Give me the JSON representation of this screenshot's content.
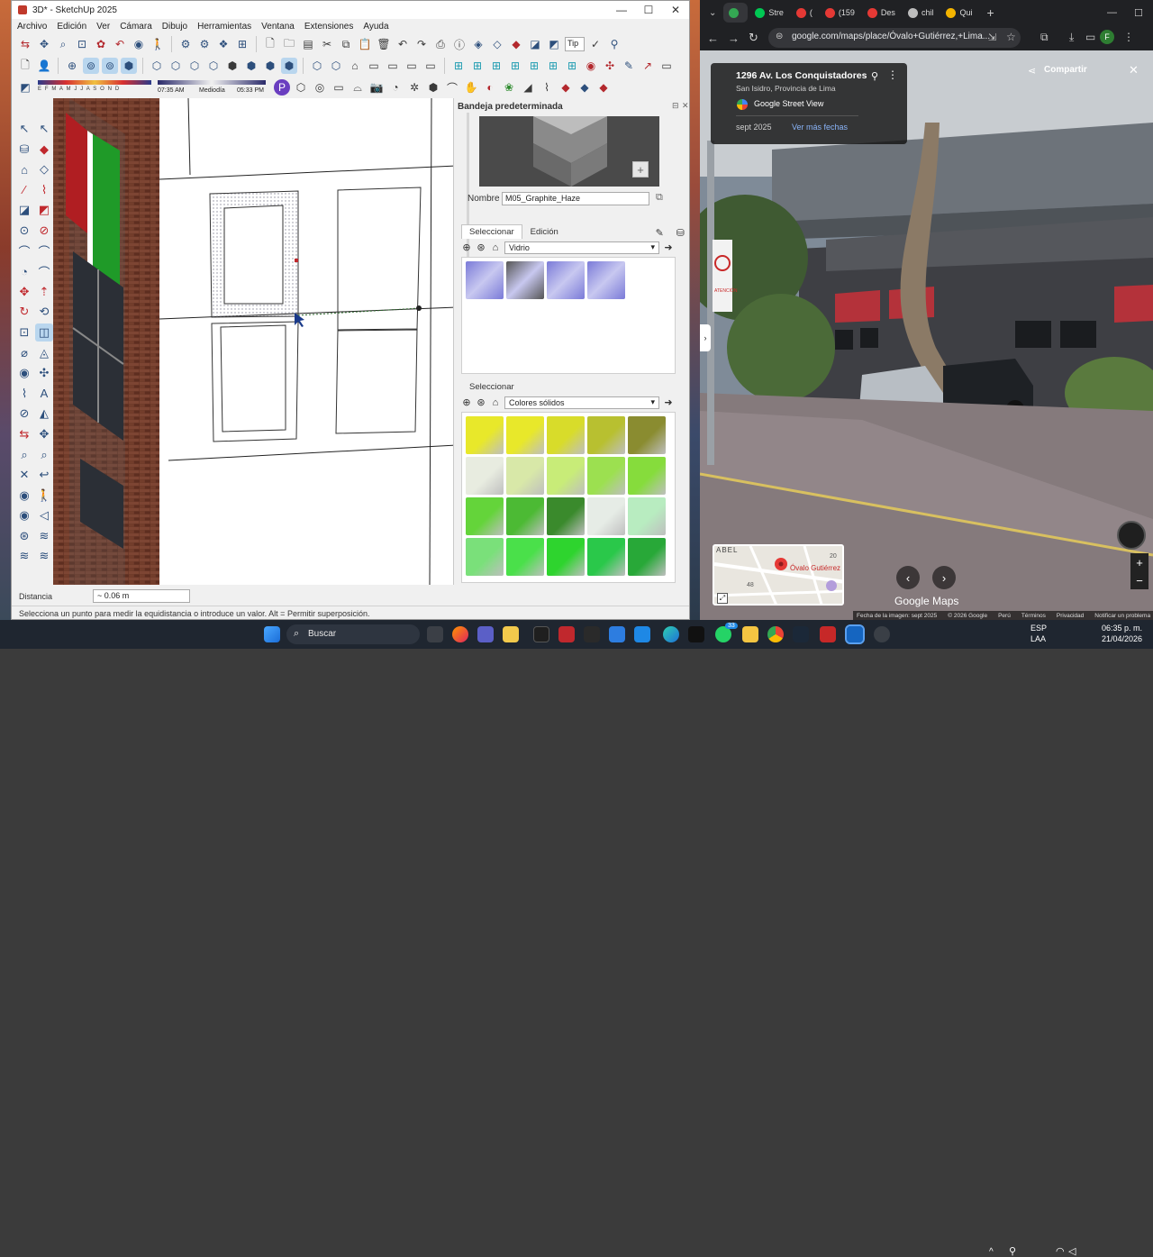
{
  "sketchup": {
    "title": "3D* - SketchUp 2025",
    "window_controls": {
      "minimize": "—",
      "maximize": "☐",
      "close": "✕"
    },
    "menu": [
      "Archivo",
      "Edición",
      "Ver",
      "Cámara",
      "Dibujo",
      "Herramientas",
      "Ventana",
      "Extensiones",
      "Ayuda"
    ],
    "toolbar_search_placeholder": "Tip",
    "shadow_bar": {
      "months": "E F M A M J J A S O N D",
      "time_start": "07:35 AM",
      "time_mid": "Mediodía",
      "time_end": "05:33 PM"
    },
    "tray": {
      "title": "Bandeja predeterminada",
      "name_label": "Nombre",
      "material_name": "M05_Graphite_Haze",
      "tabs_top": [
        "Seleccionar",
        "Edición"
      ],
      "library_top": "Vidrio",
      "tab_bottom": "Seleccionar",
      "library_bottom": "Colores sólidos",
      "glass_swatches": [
        "#7a7ad8",
        "#555555",
        "#7a7ad8",
        "#7a7ad8"
      ],
      "solid_swatches": [
        [
          "#e8e82a",
          "#e8e82a",
          "#d8dc2a",
          "#b8c030",
          "#8a8c30"
        ],
        [
          "#e8ece0",
          "#d8e8a8",
          "#c8ec78",
          "#9ce050",
          "#86dc3c"
        ],
        [
          "#64d43a",
          "#4cba34",
          "#3a8a2c",
          "#e6ece6",
          "#b8ecc0"
        ],
        [
          "#7ae07a",
          "#4ae04a",
          "#2ed42e",
          "#2ac84a",
          "#28a838"
        ]
      ]
    },
    "measure_label": "Distancia",
    "measure_value": "~ 0.06 m",
    "status": "Selecciona un punto para medir la equidistancia o introduce un valor. Alt = Permitir superposición."
  },
  "chrome": {
    "tabs": [
      {
        "label": "",
        "color": "#34a853"
      },
      {
        "label": "Stre",
        "color": "#00c853"
      },
      {
        "label": "(",
        "color": "#e53935"
      },
      {
        "label": "(159",
        "color": "#e53935"
      },
      {
        "label": "Des",
        "color": "#e53935"
      },
      {
        "label": "chil",
        "color": "#bdbdbd"
      },
      {
        "label": "Qui",
        "color": "#f4b400"
      }
    ],
    "new_tab": "+",
    "url": "google.com/maps/place/Óvalo+Gutiérrez,+Lima...",
    "profile_initial": "F",
    "place_card": {
      "address": "1296 Av. Los Conquistadores",
      "subtitle": "San Isidro, Provincia de Lima",
      "source": "Google Street View",
      "date": "sept 2025",
      "more_dates": "Ver más fechas"
    },
    "share_label": "Compartir",
    "minimap": {
      "top_label": "ABEL",
      "place": "Óvalo Gutiérrez",
      "n20": "20",
      "n48": "48"
    },
    "brand": "Google Maps",
    "footer": [
      "Fecha de la imagen: sept 2025",
      "© 2026 Google",
      "Perú",
      "Términos",
      "Privacidad",
      "Notificar un problema"
    ],
    "street_signs": {
      "atencion": "ATENCIÓN"
    }
  },
  "taskbar": {
    "search_placeholder": "Buscar",
    "lang_top": "ESP",
    "lang_bottom": "LAA",
    "time": "06:35 p. m.",
    "date": "21/04/2026",
    "badge_whatsapp": "33"
  }
}
